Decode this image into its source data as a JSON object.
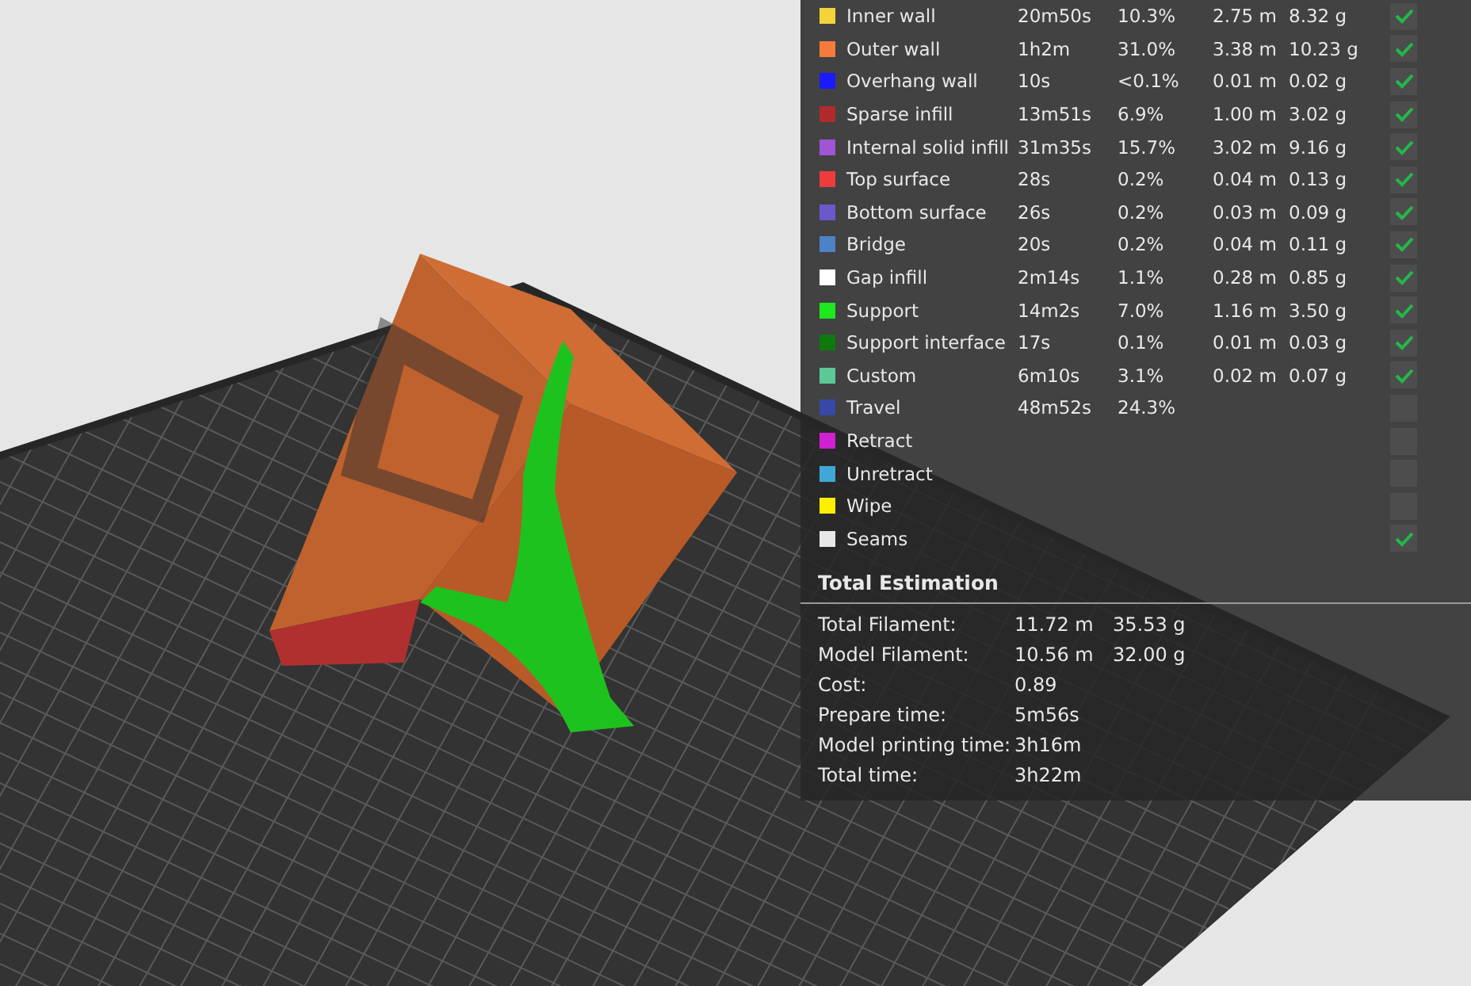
{
  "legend": {
    "rows": [
      {
        "name": "Inner wall",
        "color": "#f2d43a",
        "time": "20m50s",
        "percent": "10.3%",
        "length": "2.75 m",
        "weight": "8.32 g",
        "visible": true
      },
      {
        "name": "Outer wall",
        "color": "#f47b3a",
        "time": "1h2m",
        "percent": "31.0%",
        "length": "3.38 m",
        "weight": "10.23 g",
        "visible": true
      },
      {
        "name": "Overhang wall",
        "color": "#1a1aff",
        "time": "10s",
        "percent": "<0.1%",
        "length": "0.01 m",
        "weight": "0.02 g",
        "visible": true
      },
      {
        "name": "Sparse infill",
        "color": "#b02a2a",
        "time": "13m51s",
        "percent": "6.9%",
        "length": "1.00 m",
        "weight": "3.02 g",
        "visible": true
      },
      {
        "name": "Internal solid infill",
        "color": "#9f55d6",
        "time": "31m35s",
        "percent": "15.7%",
        "length": "3.02 m",
        "weight": "9.16 g",
        "visible": true
      },
      {
        "name": "Top surface",
        "color": "#ee3b3b",
        "time": "28s",
        "percent": "0.2%",
        "length": "0.04 m",
        "weight": "0.13 g",
        "visible": true
      },
      {
        "name": "Bottom surface",
        "color": "#6a58cc",
        "time": "26s",
        "percent": "0.2%",
        "length": "0.03 m",
        "weight": "0.09 g",
        "visible": true
      },
      {
        "name": "Bridge",
        "color": "#4e82c8",
        "time": "20s",
        "percent": "0.2%",
        "length": "0.04 m",
        "weight": "0.11 g",
        "visible": true
      },
      {
        "name": "Gap infill",
        "color": "#ffffff",
        "time": "2m14s",
        "percent": "1.1%",
        "length": "0.28 m",
        "weight": "0.85 g",
        "visible": true
      },
      {
        "name": "Support",
        "color": "#1ee81e",
        "time": "14m2s",
        "percent": "7.0%",
        "length": "1.16 m",
        "weight": "3.50 g",
        "visible": true
      },
      {
        "name": "Support interface",
        "color": "#0e7a0e",
        "time": "17s",
        "percent": "0.1%",
        "length": "0.01 m",
        "weight": "0.03 g",
        "visible": true
      },
      {
        "name": "Custom",
        "color": "#5cc896",
        "time": "6m10s",
        "percent": "3.1%",
        "length": "0.02 m",
        "weight": "0.07 g",
        "visible": true
      },
      {
        "name": "Travel",
        "color": "#3848a8",
        "time": "48m52s",
        "percent": "24.3%",
        "visible": false
      },
      {
        "name": "Retract",
        "color": "#d020d0",
        "visible": false
      },
      {
        "name": "Unretract",
        "color": "#40a8d8",
        "visible": false
      },
      {
        "name": "Wipe",
        "color": "#ffee00",
        "visible": false
      },
      {
        "name": "Seams",
        "color": "#e8e8e8",
        "visible": true
      }
    ]
  },
  "total_estimation": {
    "title": "Total Estimation",
    "rows": [
      {
        "label": "Total Filament:",
        "values": [
          "11.72 m",
          "35.53 g"
        ]
      },
      {
        "label": "Model Filament:",
        "values": [
          "10.56 m",
          "32.00 g"
        ]
      },
      {
        "label": "Cost:",
        "values": [
          "0.89"
        ]
      },
      {
        "label": "Prepare time:",
        "values": [
          "5m56s"
        ]
      },
      {
        "label": "Model printing time:",
        "values": [
          "3h16m"
        ]
      },
      {
        "label": "Total time:",
        "values": [
          "3h22m"
        ]
      }
    ]
  }
}
